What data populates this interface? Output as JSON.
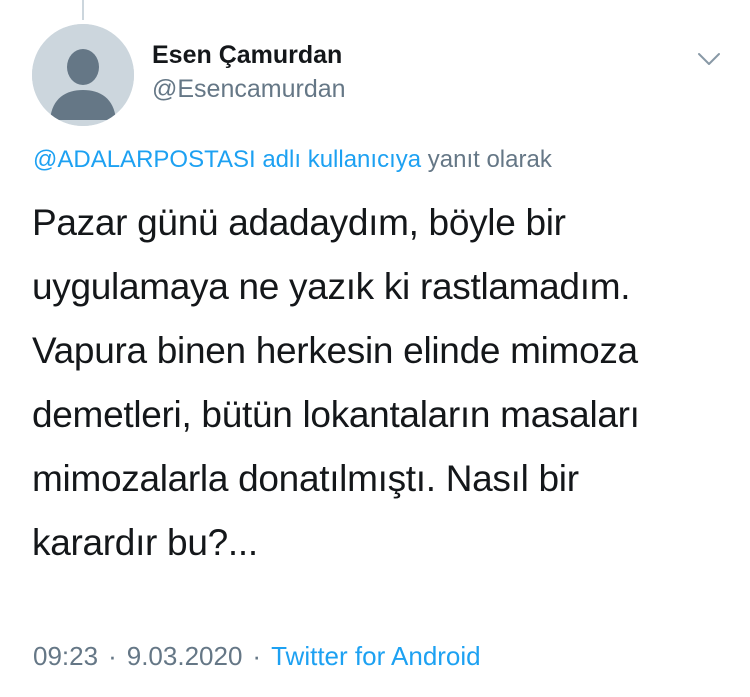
{
  "author": {
    "display_name": "Esen Çamurdan",
    "handle": "@Esencamurdan",
    "avatar_icon": "default-profile-icon"
  },
  "reply_context": {
    "mention": "@ADALARPOSTASI",
    "mention_suffix": " adlı kullanıcıya",
    "trailing": " yanıt olarak"
  },
  "tweet": {
    "lines": [
      "Pazar günü adadaydım, böyle bir",
      "uygulamaya ne yazık ki rastlamadım.",
      "Vapura binen herkesin elinde mimoza",
      "demetleri, bütün lokantaların masaları",
      "mimozalarla donatılmıştı. Nasıl bir",
      "karardır bu?..."
    ]
  },
  "meta": {
    "time": "09:23",
    "separator": "·",
    "date": "9.03.2020",
    "source": "Twitter for Android"
  },
  "menu": {
    "icon": "chevron-down-icon"
  },
  "colors": {
    "link": "#1da1f2",
    "secondary_text": "#657786",
    "primary_text": "#14171a",
    "avatar_bg": "#ccd6dd"
  }
}
